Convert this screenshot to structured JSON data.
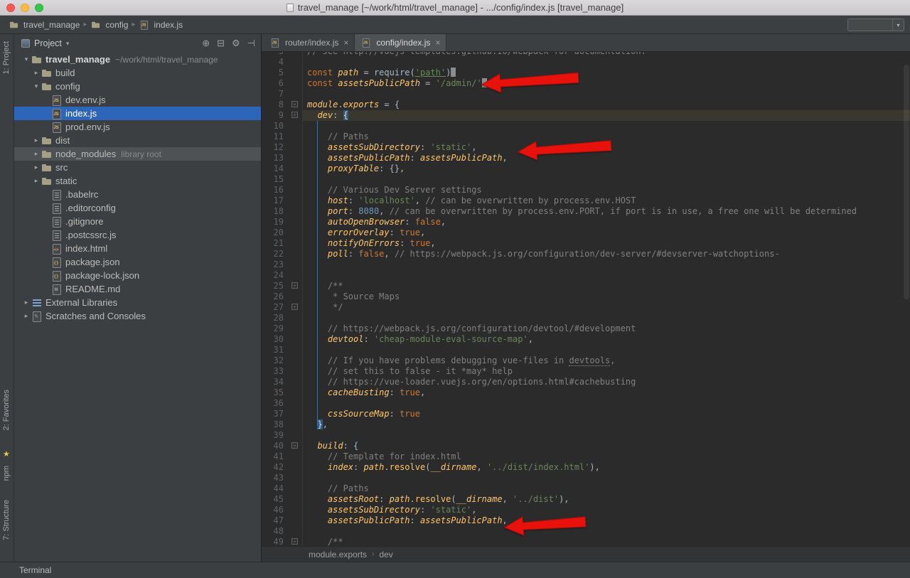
{
  "colors": {
    "selection_blue": "#2d65b8",
    "arrow_red": "#e8120c",
    "current_line": "#383830",
    "favorites_star": "#e8c64c"
  },
  "title_bar": {
    "title": "travel_manage [~/work/html/travel_manage] - .../config/index.js [travel_manage]"
  },
  "navbar": {
    "crumbs": [
      {
        "icon": "folder",
        "label": "travel_manage"
      },
      {
        "icon": "folder",
        "label": "config"
      },
      {
        "icon": "js",
        "label": "index.js"
      }
    ]
  },
  "tool_stripes": {
    "project": "1: Project",
    "favorites": "2: Favorites",
    "npm": "npm",
    "structure": "7: Structure"
  },
  "bottom_bar": {
    "terminal": "Terminal"
  },
  "project_panel": {
    "title": "Project",
    "header_icons": [
      "locate",
      "collapse-all",
      "settings",
      "hide"
    ],
    "tree": [
      {
        "indent": 0,
        "arrow": "open",
        "icon": "folder",
        "name": "travel_manage",
        "suffix": "~/work/html/travel_manage",
        "bold": true
      },
      {
        "indent": 1,
        "arrow": "closed",
        "icon": "folder",
        "name": "build"
      },
      {
        "indent": 1,
        "arrow": "open",
        "icon": "folder",
        "name": "config"
      },
      {
        "indent": 2,
        "icon": "js",
        "name": "dev.env.js"
      },
      {
        "indent": 2,
        "icon": "js",
        "name": "index.js",
        "selected": true
      },
      {
        "indent": 2,
        "icon": "js",
        "name": "prod.env.js"
      },
      {
        "indent": 1,
        "arrow": "closed",
        "icon": "folder",
        "name": "dist"
      },
      {
        "indent": 1,
        "arrow": "closed",
        "icon": "folder",
        "name": "node_modules",
        "suffix": "library root",
        "hl": true
      },
      {
        "indent": 1,
        "arrow": "closed",
        "icon": "folder",
        "name": "src"
      },
      {
        "indent": 1,
        "arrow": "closed",
        "icon": "folder",
        "name": "static"
      },
      {
        "indent": 2,
        "icon": "txt",
        "name": ".babelrc"
      },
      {
        "indent": 2,
        "icon": "txt",
        "name": ".editorconfig"
      },
      {
        "indent": 2,
        "icon": "txt",
        "name": ".gitignore"
      },
      {
        "indent": 2,
        "icon": "txt",
        "name": ".postcssrc.js"
      },
      {
        "indent": 2,
        "icon": "html",
        "name": "index.html"
      },
      {
        "indent": 2,
        "icon": "json",
        "name": "package.json"
      },
      {
        "indent": 2,
        "icon": "json",
        "name": "package-lock.json"
      },
      {
        "indent": 2,
        "icon": "md",
        "name": "README.md"
      },
      {
        "indent": 0,
        "arrow": "closed",
        "icon": "lib",
        "name": "External Libraries"
      },
      {
        "indent": 0,
        "arrow": "closed",
        "icon": "scratch",
        "name": "Scratches and Consoles"
      }
    ]
  },
  "editor": {
    "tabs": [
      {
        "label": "router/index.js",
        "active": false
      },
      {
        "label": "config/index.js",
        "active": true
      }
    ],
    "breadcrumbs": [
      "module.exports",
      "dev"
    ],
    "lines": [
      {
        "n": 3,
        "t": [
          [
            "c",
            "// see http://vuejs-templates.github.io/webpack for documentation."
          ]
        ]
      },
      {
        "n": 4,
        "t": []
      },
      {
        "n": 5,
        "t": [
          [
            "k",
            "const "
          ],
          [
            "p",
            "path"
          ],
          [
            "d",
            " = "
          ],
          [
            "d",
            "require("
          ],
          [
            "su",
            "'path'"
          ],
          [
            "d",
            ")"
          ],
          [
            "caret",
            ""
          ]
        ]
      },
      {
        "n": 6,
        "t": [
          [
            "k",
            "const "
          ],
          [
            "p",
            "assetsPublicPath"
          ],
          [
            "d",
            " = "
          ],
          [
            "s",
            "'/admin/'"
          ],
          [
            "caret",
            ""
          ]
        ]
      },
      {
        "n": 7,
        "t": []
      },
      {
        "n": 8,
        "fold": true,
        "t": [
          [
            "p",
            "module"
          ],
          [
            "d",
            "."
          ],
          [
            "p",
            "exports"
          ],
          [
            "d",
            " = {"
          ]
        ]
      },
      {
        "n": 9,
        "fold": true,
        "current": true,
        "t": [
          [
            "d",
            "  "
          ],
          [
            "p",
            "dev"
          ],
          [
            "d",
            ": "
          ],
          [
            "bm",
            "{"
          ]
        ]
      },
      {
        "n": 10,
        "t": []
      },
      {
        "n": 11,
        "t": [
          [
            "c",
            "    // Paths"
          ]
        ]
      },
      {
        "n": 12,
        "t": [
          [
            "d",
            "    "
          ],
          [
            "p",
            "assetsSubDirectory"
          ],
          [
            "d",
            ": "
          ],
          [
            "s",
            "'static'"
          ],
          [
            "d",
            ","
          ]
        ]
      },
      {
        "n": 13,
        "t": [
          [
            "d",
            "    "
          ],
          [
            "p",
            "assetsPublicPath"
          ],
          [
            "d",
            ": "
          ],
          [
            "p",
            "assetsPublicPath"
          ],
          [
            "d",
            ","
          ]
        ]
      },
      {
        "n": 14,
        "t": [
          [
            "d",
            "    "
          ],
          [
            "p",
            "proxyTable"
          ],
          [
            "d",
            ": {},"
          ]
        ]
      },
      {
        "n": 15,
        "t": []
      },
      {
        "n": 16,
        "t": [
          [
            "c",
            "    // Various Dev Server settings"
          ]
        ]
      },
      {
        "n": 17,
        "t": [
          [
            "d",
            "    "
          ],
          [
            "p",
            "host"
          ],
          [
            "d",
            ": "
          ],
          [
            "s",
            "'localhost'"
          ],
          [
            "d",
            ", "
          ],
          [
            "c",
            "// can be overwritten by process.env.HOST"
          ]
        ]
      },
      {
        "n": 18,
        "t": [
          [
            "d",
            "    "
          ],
          [
            "p",
            "port"
          ],
          [
            "d",
            ": "
          ],
          [
            "n",
            "8080"
          ],
          [
            "d",
            ", "
          ],
          [
            "c",
            "// can be overwritten by process.env.PORT, if port is in use, a free one will be determined"
          ]
        ]
      },
      {
        "n": 19,
        "t": [
          [
            "d",
            "    "
          ],
          [
            "p",
            "autoOpenBrowser"
          ],
          [
            "d",
            ": "
          ],
          [
            "k",
            "false"
          ],
          [
            "d",
            ","
          ]
        ]
      },
      {
        "n": 20,
        "t": [
          [
            "d",
            "    "
          ],
          [
            "p",
            "errorOverlay"
          ],
          [
            "d",
            ": "
          ],
          [
            "k",
            "true"
          ],
          [
            "d",
            ","
          ]
        ]
      },
      {
        "n": 21,
        "t": [
          [
            "d",
            "    "
          ],
          [
            "p",
            "notifyOnErrors"
          ],
          [
            "d",
            ": "
          ],
          [
            "k",
            "true"
          ],
          [
            "d",
            ","
          ]
        ]
      },
      {
        "n": 22,
        "t": [
          [
            "d",
            "    "
          ],
          [
            "p",
            "poll"
          ],
          [
            "d",
            ": "
          ],
          [
            "k",
            "false"
          ],
          [
            "d",
            ", "
          ],
          [
            "c",
            "// https://webpack.js.org/configuration/dev-server/#devserver-watchoptions-"
          ]
        ]
      },
      {
        "n": 23,
        "t": []
      },
      {
        "n": 24,
        "t": []
      },
      {
        "n": 25,
        "fold": true,
        "t": [
          [
            "c",
            "    /**"
          ]
        ]
      },
      {
        "n": 26,
        "t": [
          [
            "c",
            "     * Source Maps"
          ]
        ]
      },
      {
        "n": 27,
        "fold": true,
        "t": [
          [
            "c",
            "     */"
          ]
        ]
      },
      {
        "n": 28,
        "t": []
      },
      {
        "n": 29,
        "t": [
          [
            "c",
            "    // https://webpack.js.org/configuration/devtool/#development"
          ]
        ]
      },
      {
        "n": 30,
        "t": [
          [
            "d",
            "    "
          ],
          [
            "p",
            "devtool"
          ],
          [
            "d",
            ": "
          ],
          [
            "s",
            "'cheap-module-eval-source-map'"
          ],
          [
            "d",
            ","
          ]
        ]
      },
      {
        "n": 31,
        "t": []
      },
      {
        "n": 32,
        "t": [
          [
            "c",
            "    // If you have problems debugging vue-files in "
          ],
          [
            "cu",
            "devtools"
          ],
          [
            "c",
            ","
          ]
        ]
      },
      {
        "n": 33,
        "t": [
          [
            "c",
            "    // set this to false - it *may* help"
          ]
        ]
      },
      {
        "n": 34,
        "t": [
          [
            "c",
            "    // https://vue-loader.vuejs.org/en/options.html#cachebusting"
          ]
        ]
      },
      {
        "n": 35,
        "t": [
          [
            "d",
            "    "
          ],
          [
            "p",
            "cacheBusting"
          ],
          [
            "d",
            ": "
          ],
          [
            "k",
            "true"
          ],
          [
            "d",
            ","
          ]
        ]
      },
      {
        "n": 36,
        "t": []
      },
      {
        "n": 37,
        "t": [
          [
            "d",
            "    "
          ],
          [
            "p",
            "cssSourceMap"
          ],
          [
            "d",
            ": "
          ],
          [
            "k",
            "true"
          ]
        ]
      },
      {
        "n": 38,
        "t": [
          [
            "d",
            "  "
          ],
          [
            "bm",
            "}"
          ],
          [
            "d",
            ","
          ]
        ]
      },
      {
        "n": 39,
        "t": []
      },
      {
        "n": 40,
        "fold": true,
        "t": [
          [
            "d",
            "  "
          ],
          [
            "p",
            "build"
          ],
          [
            "d",
            ": {"
          ]
        ]
      },
      {
        "n": 41,
        "t": [
          [
            "c",
            "    // Template for index.html"
          ]
        ]
      },
      {
        "n": 42,
        "t": [
          [
            "d",
            "    "
          ],
          [
            "p",
            "index"
          ],
          [
            "d",
            ": "
          ],
          [
            "p",
            "path"
          ],
          [
            "d",
            "."
          ],
          [
            "f",
            "resolve"
          ],
          [
            "d",
            "("
          ],
          [
            "p",
            "__dirname"
          ],
          [
            "d",
            ", "
          ],
          [
            "s",
            "'../dist/index.html'"
          ],
          [
            "d",
            "),"
          ]
        ]
      },
      {
        "n": 43,
        "t": []
      },
      {
        "n": 44,
        "t": [
          [
            "c",
            "    // Paths"
          ]
        ]
      },
      {
        "n": 45,
        "t": [
          [
            "d",
            "    "
          ],
          [
            "p",
            "assetsRoot"
          ],
          [
            "d",
            ": "
          ],
          [
            "p",
            "path"
          ],
          [
            "d",
            "."
          ],
          [
            "f",
            "resolve"
          ],
          [
            "d",
            "("
          ],
          [
            "p",
            "__dirname"
          ],
          [
            "d",
            ", "
          ],
          [
            "s",
            "'../dist'"
          ],
          [
            "d",
            "),"
          ]
        ]
      },
      {
        "n": 46,
        "t": [
          [
            "d",
            "    "
          ],
          [
            "p",
            "assetsSubDirectory"
          ],
          [
            "d",
            ": "
          ],
          [
            "s",
            "'static'"
          ],
          [
            "d",
            ","
          ]
        ]
      },
      {
        "n": 47,
        "t": [
          [
            "d",
            "    "
          ],
          [
            "p",
            "assetsPublicPath"
          ],
          [
            "d",
            ": "
          ],
          [
            "p",
            "assetsPublicPath"
          ],
          [
            "d",
            ","
          ]
        ]
      },
      {
        "n": 48,
        "t": []
      },
      {
        "n": 49,
        "fold": true,
        "t": [
          [
            "c",
            "    /**"
          ]
        ]
      }
    ]
  }
}
